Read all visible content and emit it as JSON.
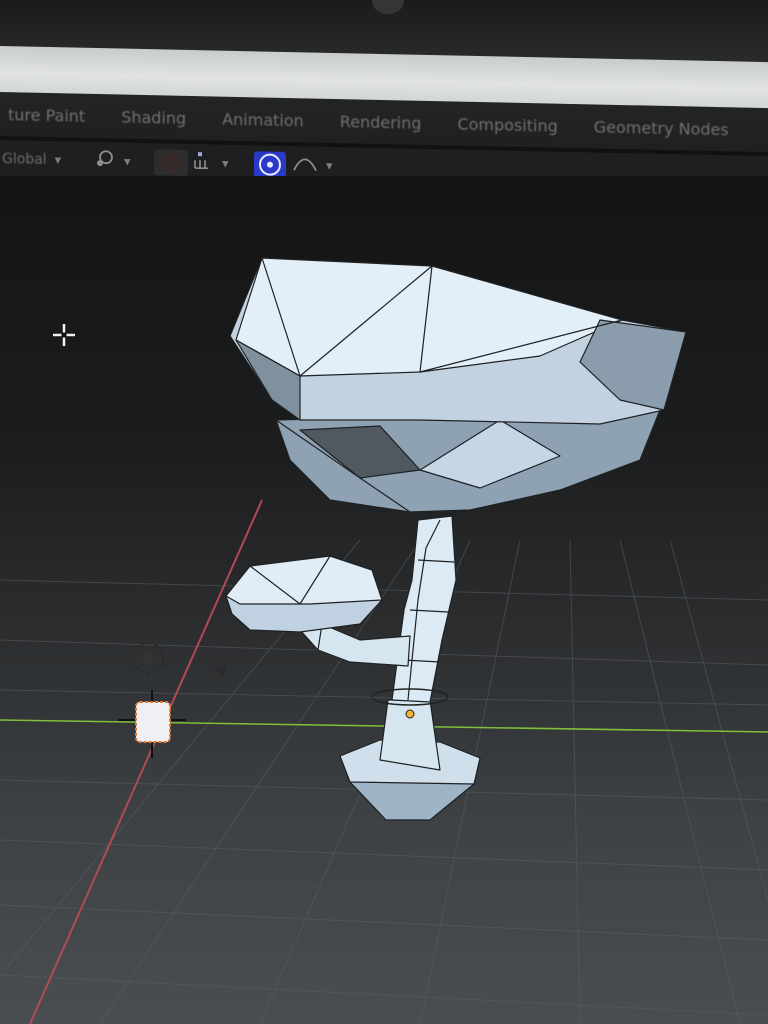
{
  "workspace_tabs": [
    "ture Paint",
    "Shading",
    "Animation",
    "Rendering",
    "Compositing",
    "Geometry Nodes"
  ],
  "header_toolbar": {
    "orientation_label": "Global",
    "chevron": "▾",
    "pivot_icon": "pivot-point-icon",
    "snap_icon": "snap-increment-icon",
    "proportional_icon": "proportional-editing-icon",
    "falloff_icon": "falloff-curve-icon"
  },
  "colors": {
    "viewport_top": "#141414",
    "viewport_bottom": "#4a4e52",
    "x_axis": "#b24a55",
    "y_axis": "#7fbf3a",
    "mesh_face": "#b7c6d6",
    "mesh_edge": "#202224",
    "active_button": "#2a3ac8"
  }
}
